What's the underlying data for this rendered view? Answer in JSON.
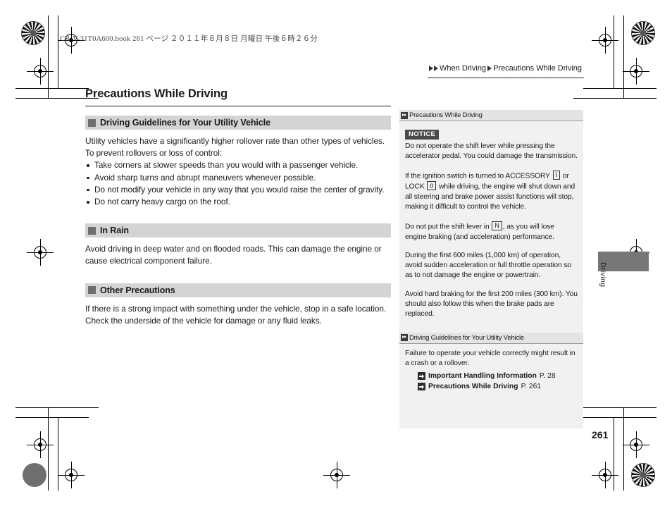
{
  "print_info": {
    "book_line": "CR-V-31T0A600.book   261 ページ   ２０１１年８月８日   月曜日   午後６時２６分"
  },
  "breadcrumb": {
    "parent": "When Driving",
    "current": "Precautions While Driving"
  },
  "main": {
    "page_title": "Precautions While Driving",
    "sections": [
      {
        "heading": "Driving Guidelines for Your Utility Vehicle",
        "intro": "Utility vehicles have a significantly higher rollover rate than other types of vehicles. To prevent rollovers or loss of control:",
        "bullets": [
          "Take corners at slower speeds than you would with a passenger vehicle.",
          "Avoid sharp turns and abrupt maneuvers whenever possible.",
          "Do not modify your vehicle in any way that you would raise the center of gravity.",
          "Do not carry heavy cargo on the roof."
        ]
      },
      {
        "heading": "In Rain",
        "body": "Avoid driving in deep water and on flooded roads. This can damage the engine or cause electrical component failure."
      },
      {
        "heading": "Other Precautions",
        "body": "If there is a strong impact with something under the vehicle, stop in a safe location. Check the underside of the vehicle for damage or any fluid leaks."
      }
    ]
  },
  "sidebar": {
    "section1": {
      "title": "Precautions While Driving",
      "notice_label": "NOTICE",
      "para1": "Do not operate the shift lever while pressing the accelerator pedal. You could damage the transmission.",
      "para2_a": "If the ignition switch is turned to ACCESSORY",
      "key_accessory": "I",
      "para2_b": "or LOCK",
      "key_lock": "0",
      "para2_c": "while driving, the engine will shut down and all steering and brake power assist functions will stop, making it difficult to control the vehicle.",
      "para3_a": "Do not put the shift lever in",
      "key_neutral": "N",
      "para3_b": ", as you will lose engine braking (and acceleration) performance.",
      "para4": "During the first 600 miles (1,000 km) of operation, avoid sudden acceleration or full throttle operation so as to not damage the engine or powertrain.",
      "para5": "Avoid hard braking for the first 200 miles (300 km). You should also follow this when the brake pads are replaced."
    },
    "section2": {
      "title": "Driving Guidelines for Your Utility Vehicle",
      "para1": "Failure to operate your vehicle correctly might result in a crash or a rollover.",
      "refs": [
        {
          "name": "Important Handling Information",
          "page": "P. 28"
        },
        {
          "name": "Precautions While Driving",
          "page": "P. 261"
        }
      ]
    }
  },
  "thumb_tab": {
    "label": "Driving"
  },
  "footer": {
    "page_number": "261"
  },
  "colors": {
    "section_bar": "#d4d4d4",
    "section_square": "#6e6e6e",
    "sidebar_bg": "#f1f1f1",
    "sidebar_head": "#e4e4e4",
    "notice_bg": "#4a4a4a",
    "tab_gray": "#767676"
  }
}
